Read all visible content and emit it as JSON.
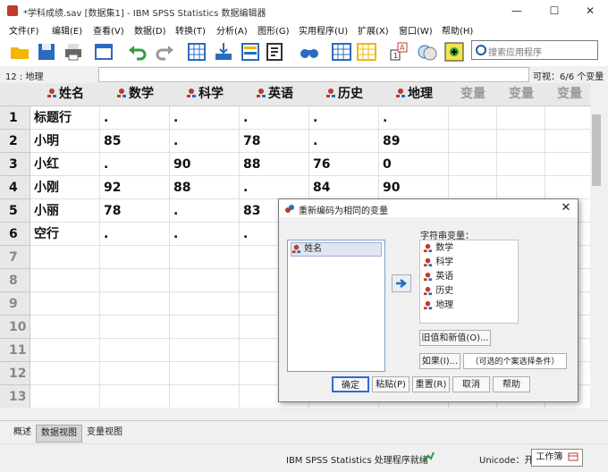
{
  "window": {
    "title": "*学科成绩.sav [数据集1] - IBM SPSS Statistics 数据编辑器",
    "min_glyph": "—",
    "max_glyph": "☐",
    "close_glyph": "✕"
  },
  "menu": [
    "文件(F)",
    "编辑(E)",
    "查看(V)",
    "数据(D)",
    "转换(T)",
    "分析(A)",
    "图形(G)",
    "实用程序(U)",
    "扩展(X)",
    "窗口(W)",
    "帮助(H)"
  ],
  "search": {
    "placeholder": "搜索应用程序"
  },
  "refbar": {
    "cell_ref": "12 : 地理",
    "visible": "可视：6/6 个变量"
  },
  "grid": {
    "columns": [
      "姓名",
      "数学",
      "科学",
      "英语",
      "历史",
      "地理",
      "变量",
      "变量",
      "变量"
    ],
    "row_numbers": [
      "1",
      "2",
      "3",
      "4",
      "5",
      "6",
      "7",
      "8",
      "9",
      "10",
      "11",
      "12",
      "13"
    ],
    "rows": [
      [
        "标题行",
        ".",
        ".",
        ".",
        ".",
        "."
      ],
      [
        "小明",
        "85",
        ".",
        "78",
        ".",
        "89"
      ],
      [
        "小红",
        ".",
        "90",
        "88",
        "76",
        "0"
      ],
      [
        "小刚",
        "92",
        "88",
        ".",
        "84",
        "90"
      ],
      [
        "小丽",
        "78",
        ".",
        "83",
        "",
        ""
      ],
      [
        "空行",
        ".",
        ".",
        ".",
        "",
        ""
      ]
    ]
  },
  "tabs": [
    "概述",
    "数据视图",
    "变量视图"
  ],
  "status": {
    "processor": "IBM SPSS Statistics 处理程序就绪",
    "unicode": "Unicode：开",
    "workbook": "工作簿"
  },
  "dialog": {
    "title": "重新编码为相同的变量",
    "source_list": [
      "姓名"
    ],
    "target_label": "字符串变量：",
    "target_list": [
      "数学",
      "科学",
      "英语",
      "历史",
      "地理"
    ],
    "old_new_btn": "旧值和新值(O)...",
    "if_btn": "如果(I)...",
    "if_hint": "（可选的个案选择条件）",
    "ok": "确定",
    "paste": "粘贴(P)",
    "reset": "重置(R)",
    "cancel": "取消",
    "help": "帮助"
  },
  "colors": {
    "accent": "#2f6ad8",
    "grid_header": "#e8e8e8"
  }
}
